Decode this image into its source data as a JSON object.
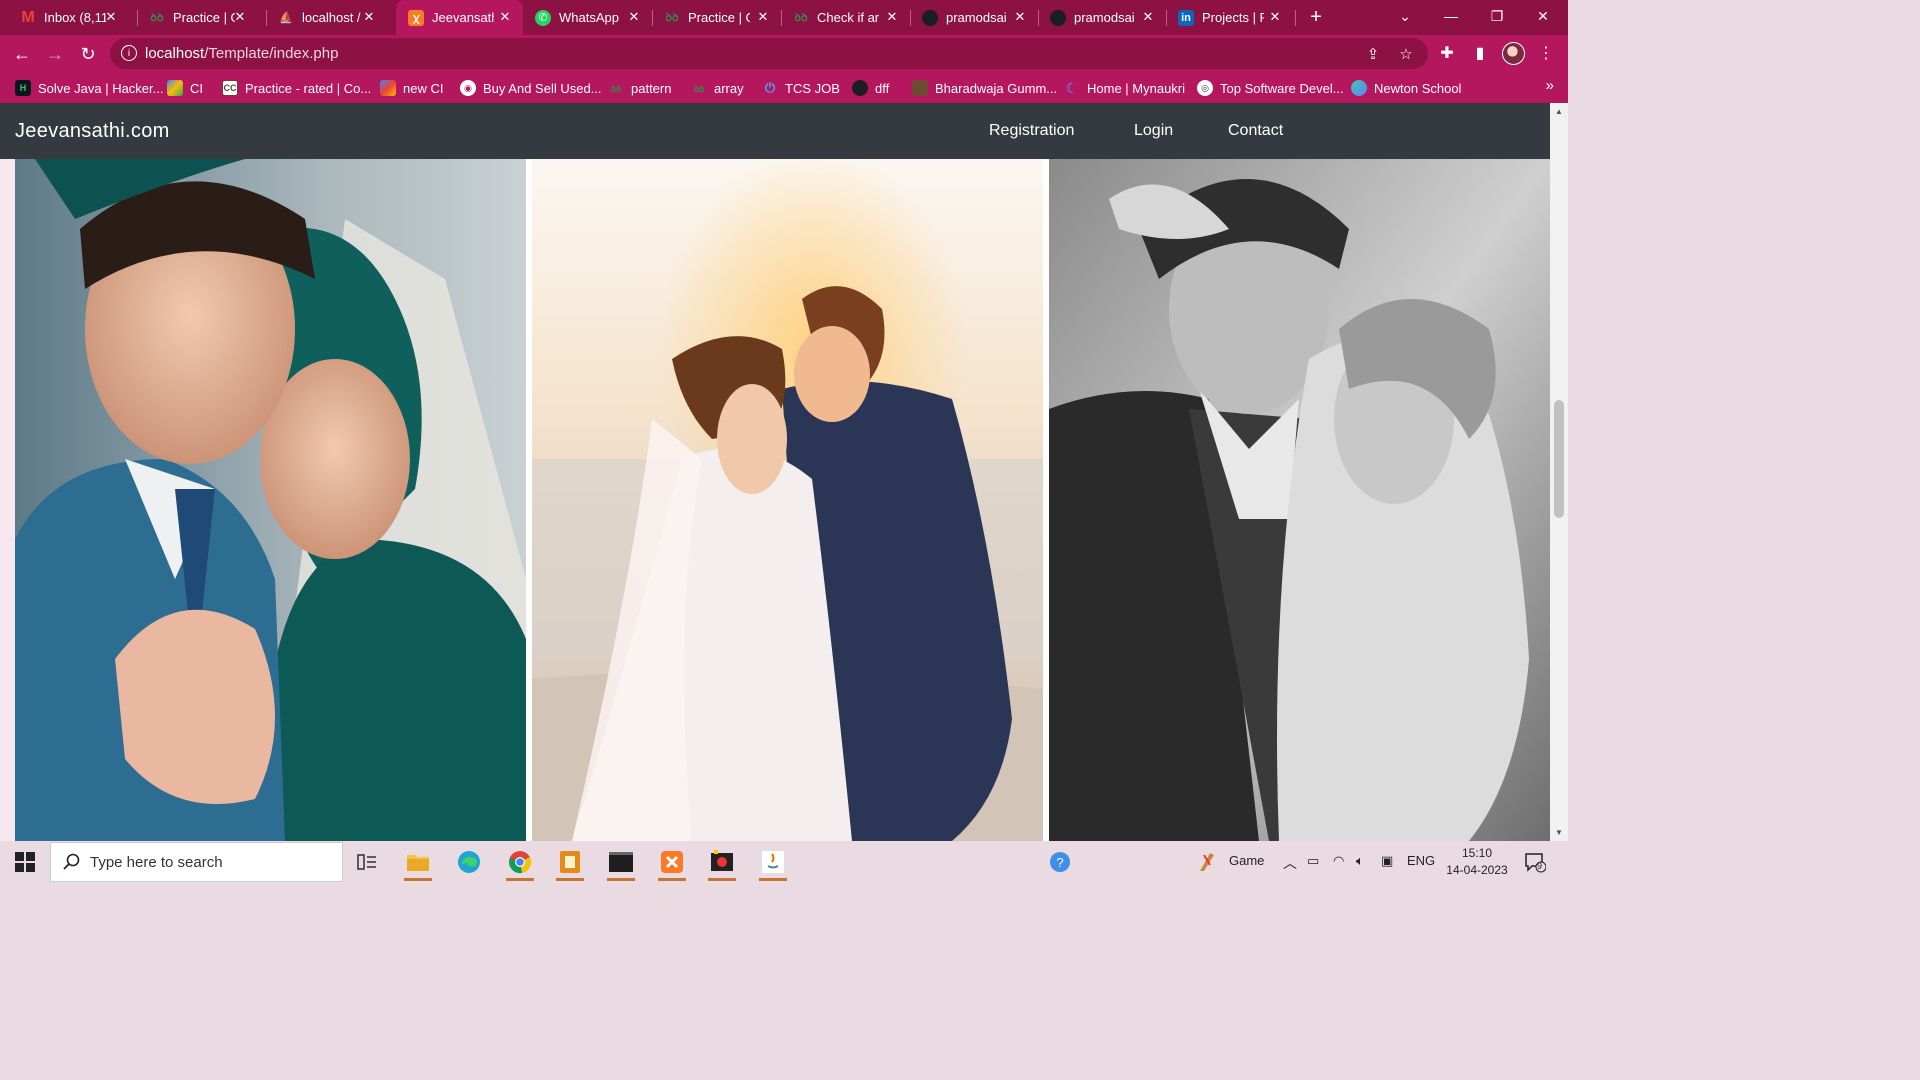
{
  "browser": {
    "tabs": [
      {
        "label": "Inbox (8,11",
        "icon": "gmail-icon",
        "active": false
      },
      {
        "label": "Practice | G",
        "icon": "gfg-icon",
        "active": false
      },
      {
        "label": "localhost /",
        "icon": "phpmyadmin-icon",
        "active": false
      },
      {
        "label": "Jeevansathi",
        "icon": "xampp-icon",
        "active": true
      },
      {
        "label": "WhatsApp",
        "icon": "whatsapp-icon",
        "active": false
      },
      {
        "label": "Practice | G",
        "icon": "gfg-icon",
        "active": false
      },
      {
        "label": "Check if arr",
        "icon": "gfg-icon",
        "active": false
      },
      {
        "label": "pramodsai",
        "icon": "github-icon",
        "active": false
      },
      {
        "label": "pramodsai",
        "icon": "github-icon",
        "active": false
      },
      {
        "label": "Projects | P",
        "icon": "linkedin-icon",
        "active": false
      }
    ],
    "address": {
      "host": "localhost",
      "path": "/Template/index.php"
    },
    "bookmarks": [
      {
        "label": "Solve Java | Hacker...",
        "icon": "hackerrank-icon"
      },
      {
        "label": "CI",
        "icon": "colorful-cube-icon"
      },
      {
        "label": "Practice - rated | Co...",
        "icon": "codechef-icon"
      },
      {
        "label": "new CI",
        "icon": "colorful-cube-icon"
      },
      {
        "label": "Buy And Sell Used...",
        "icon": "globe-icon"
      },
      {
        "label": "pattern",
        "icon": "gfg-icon"
      },
      {
        "label": "array",
        "icon": "gfg-icon"
      },
      {
        "label": "TCS JOB",
        "icon": "power-icon"
      },
      {
        "label": "dff",
        "icon": "github-icon"
      },
      {
        "label": "Bharadwaja Gumm...",
        "icon": "profile-photo-icon"
      },
      {
        "label": "Home | Mynaukri",
        "icon": "moon-icon"
      },
      {
        "label": "Top Software Devel...",
        "icon": "chrome-like-icon"
      },
      {
        "label": "Newton School",
        "icon": "newton-icon"
      }
    ]
  },
  "site": {
    "brand": "Jeevansathi.com",
    "nav": [
      "Registration",
      "Login",
      "Contact"
    ]
  },
  "gallery": [
    {
      "name": "couple-teal-photo"
    },
    {
      "name": "beach-sunset-couple-photo"
    },
    {
      "name": "bw-couple-photo"
    }
  ],
  "taskbar": {
    "search_placeholder": "Type here to search",
    "weather_label": "Game",
    "language": "ENG",
    "time": "15:10",
    "date": "14-04-2023",
    "notification_count": "9"
  }
}
